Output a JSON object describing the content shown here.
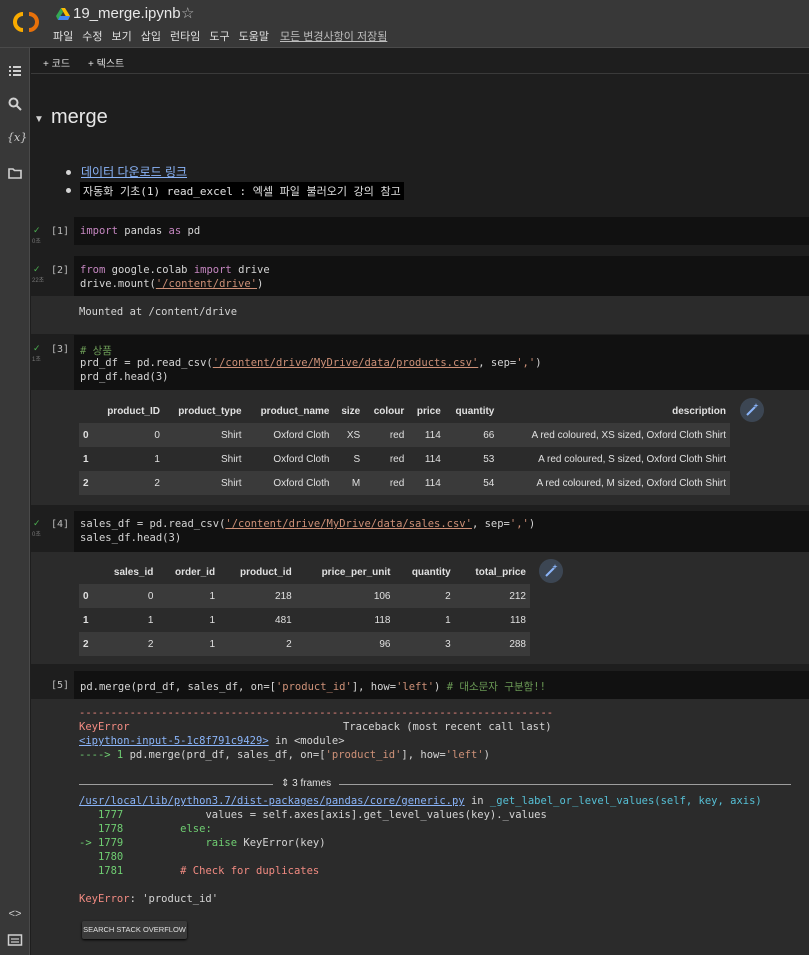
{
  "header": {
    "title": "19_merge.ipynb",
    "menu": [
      "파일",
      "수정",
      "보기",
      "삽입",
      "런타임",
      "도구",
      "도움말"
    ],
    "saved_status": "모든 변경사항이 저장됨"
  },
  "toolbar": {
    "add_code": "+ 코드",
    "add_text": "+ 텍스트"
  },
  "notebook": {
    "heading": "merge",
    "bullets": {
      "link": "데이터 다운로드 링크",
      "note": "자동화 기초(1) read_excel : 엑셀 파일 불러오기 강의 참고"
    },
    "cells": {
      "c1": {
        "count": "[1]",
        "time": "0초",
        "line1": "pandas as pd",
        "kw1": "import",
        "kw2": "as"
      },
      "c2": {
        "count": "[2]",
        "time": "22초",
        "line1_a": "from",
        "line1_b": "google.colab",
        "line1_c": "import",
        "line1_d": "drive",
        "line2_a": "drive.mount(",
        "line2_str": "'/content/drive'",
        "line2_b": ")",
        "output": "Mounted at /content/drive"
      },
      "c3": {
        "count": "[3]",
        "time": "1초",
        "comment": "# 상품",
        "line2_a": "prd_df = pd.read_csv(",
        "line2_str": "'/content/drive/MyDrive/data/products.csv'",
        "line2_b": ", sep=",
        "line2_sep": "','",
        "line2_c": ")",
        "line3": "prd_df.head(3)"
      },
      "c4": {
        "count": "[4]",
        "time": "0초",
        "line1_a": "sales_df = pd.read_csv(",
        "line1_str": "'/content/drive/MyDrive/data/sales.csv'",
        "line1_b": ", sep=",
        "line1_sep": "','",
        "line1_c": ")",
        "line2": "sales_df.head(3)"
      },
      "c5": {
        "count": "[5]",
        "line_a": "pd.merge(prd_df, sales_df, on=[",
        "line_str1": "'product_id'",
        "line_b": "], how=",
        "line_str2": "'left'",
        "line_c": ")",
        "line_comment": "# 대소문자 구분함!!"
      }
    },
    "products_table": {
      "columns": [
        "",
        "product_ID",
        "product_type",
        "product_name",
        "size",
        "colour",
        "price",
        "quantity",
        "description"
      ],
      "rows": [
        [
          "0",
          "0",
          "Shirt",
          "Oxford Cloth",
          "XS",
          "red",
          "114",
          "66",
          "A red coloured, XS sized, Oxford Cloth Shirt"
        ],
        [
          "1",
          "1",
          "Shirt",
          "Oxford Cloth",
          "S",
          "red",
          "114",
          "53",
          "A red coloured, S sized, Oxford Cloth Shirt"
        ],
        [
          "2",
          "2",
          "Shirt",
          "Oxford Cloth",
          "M",
          "red",
          "114",
          "54",
          "A red coloured, M sized, Oxford Cloth Shirt"
        ]
      ]
    },
    "sales_table": {
      "columns": [
        "",
        "sales_id",
        "order_id",
        "product_id",
        "price_per_unit",
        "quantity",
        "total_price"
      ],
      "rows": [
        [
          "0",
          "0",
          "1",
          "218",
          "106",
          "2",
          "212"
        ],
        [
          "1",
          "1",
          "1",
          "481",
          "118",
          "1",
          "118"
        ],
        [
          "2",
          "2",
          "1",
          "2",
          "96",
          "3",
          "288"
        ]
      ]
    },
    "traceback": {
      "dashes": "---------------------------------------------------------------------------",
      "error_name": "KeyError",
      "tb_header": "Traceback (most recent call last)",
      "input_link": "<ipython-input-5-1c8f791c9429>",
      "in_module": " in <module>",
      "arrow1": "----> 1 ",
      "arrow1_code_a": "pd.merge(prd_df, sales_df, on=[",
      "arrow1_str1": "'product_id'",
      "arrow1_code_b": "], how=",
      "arrow1_str2": "'left'",
      "arrow1_code_c": ")",
      "frames": "3 frames",
      "file_link": "/usr/local/lib/python3.7/dist-packages/pandas/core/generic.py",
      "file_in": " in ",
      "file_func": "_get_label_or_level_values(self, key, axis)",
      "l1777_num": "   1777",
      "l1777_code": "             values = self.axes[axis].get_level_values(key)._values",
      "l1778_num": "   1778",
      "l1778_code": "         else:",
      "l1779_num": "-> 1779",
      "l1779_code_a": "             ",
      "l1779_code_kw": "raise",
      "l1779_code_b": " KeyError(key)",
      "l1780_num": "   1780",
      "l1781_num": "   1781",
      "l1781_code": "         # Check for duplicates",
      "final_name": "KeyError",
      "final_msg": ": 'product_id'",
      "so_button": "SEARCH STACK OVERFLOW"
    }
  }
}
